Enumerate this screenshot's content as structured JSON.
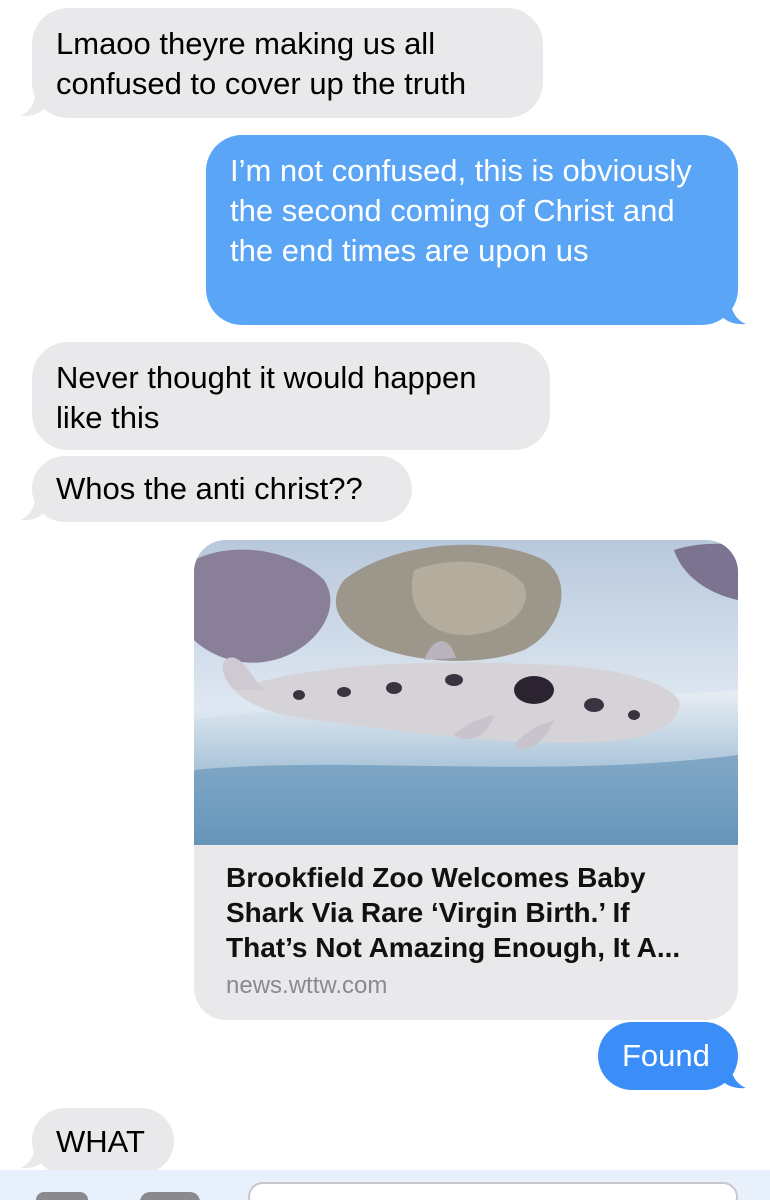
{
  "messages": [
    {
      "from": "them",
      "text": "Lmaoo theyre making us all confused to cover up the truth"
    },
    {
      "from": "me",
      "text": "I’m not confused, this is obviously the second coming of Christ and the end times are upon us"
    },
    {
      "from": "them",
      "text": "Never thought it would happen like this"
    },
    {
      "from": "them",
      "text": "Whos the anti christ??"
    },
    {
      "from": "me",
      "type": "link",
      "title": "Brookfield Zoo Welcomes Baby Shark Via Rare ‘Virgin Birth.’ If That’s Not Amazing Enough, It A...",
      "domain": "news.wttw.com"
    },
    {
      "from": "me",
      "text": "Found"
    },
    {
      "from": "them",
      "text": "WHAT"
    }
  ],
  "colors": {
    "incoming_bubble": "#e9e9eb",
    "outgoing_bubble": "#3b8ef7",
    "outgoing_bubble_light": "#5aa5f5",
    "incoming_text": "#000000",
    "outgoing_text": "#ffffff",
    "domain_text": "#8a8a8e"
  },
  "icons": [
    "camera-icon",
    "apps-icon",
    "message-input"
  ]
}
